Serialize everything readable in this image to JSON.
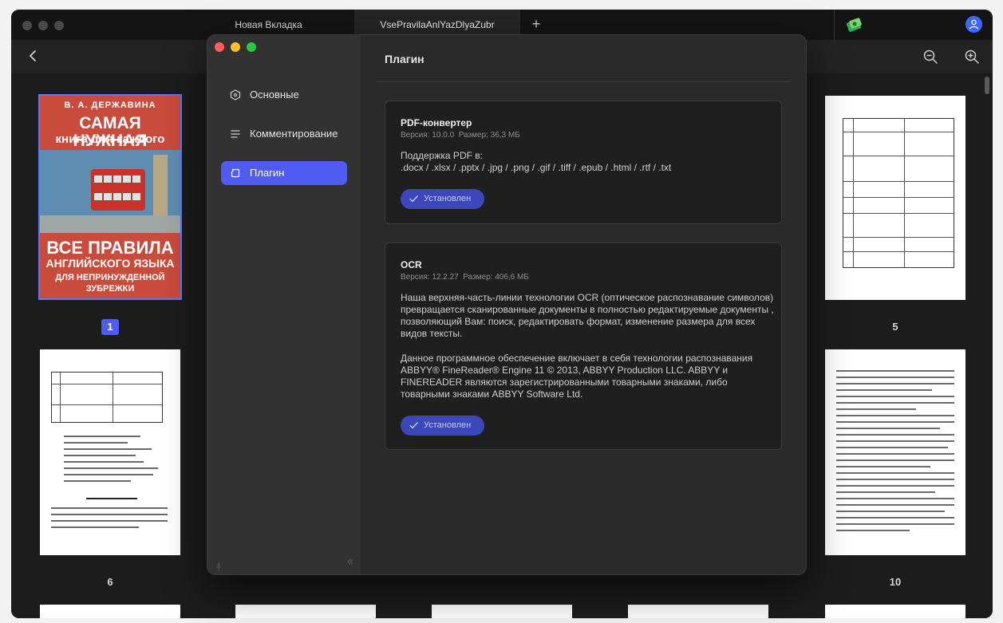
{
  "browser": {
    "tabs": [
      "Новая Вкладка",
      "VsePravilaAnlYazDlyaZubr"
    ],
    "add_tab": "+"
  },
  "icons": {
    "back": "chevron-left-icon",
    "zoom_out": "zoom-out-icon",
    "zoom_in": "zoom-in-icon",
    "extension": "extension-icon",
    "avatar": "user-avatar-icon"
  },
  "thumbnails": {
    "cover": {
      "author": "В. А. ДЕРЖАВИНА",
      "title_line1": "САМАЯ НУЖНАЯ",
      "title_line2": "книга для каждого",
      "bottom_line1": "ВСЕ ПРАВИЛА",
      "bottom_line2": "АНГЛИЙСКОГО ЯЗЫКА",
      "bottom_line3": "ДЛЯ НЕПРИНУЖДЕННОЙ",
      "bottom_line4": "ЗУБРЕЖКИ"
    },
    "pages": [
      "1",
      "5",
      "6",
      "10"
    ],
    "selected_page": "1"
  },
  "dialog": {
    "nav": [
      {
        "label": "Основные",
        "icon": "hexagon-icon"
      },
      {
        "label": "Комментирование",
        "icon": "lines-icon"
      },
      {
        "label": "Плагин",
        "icon": "plugin-icon"
      }
    ],
    "active_nav": "Плагин",
    "title": "Плагин",
    "plugins": [
      {
        "name": "PDF-конвертер",
        "version": "Версия: 10.0.0",
        "size": "Размер: 36,3 МБ",
        "desc1": "Поддержка PDF в:",
        "desc2": ".docx / .xlsx / .pptx / .jpg / .png / .gif / .tiff / .epub / .html / .rtf / .txt",
        "status": "Установлен"
      },
      {
        "name": "OCR",
        "version": "Версия: 12.2.27",
        "size": "Размер: 406,6 МБ",
        "desc1": "Наша верхняя-часть-линии технологии OCR (оптическое распознавание символов) превращается сканированные документы в полностью редактируемые документы , позволяющий Вам: поиск, редактировать формат, изменение размера для всех видов тексты.",
        "desc2": "Данное программное обеспечение включает в себя технологии распознавания ABBYY® FineReader® Engine 11 © 2013, ABBYY Production LLC. ABBYY и FINEREADER являются зарегистрированными товарными знаками, либо товарными знаками ABBYY Software Ltd.",
        "status": "Установлен"
      }
    ]
  },
  "colors": {
    "accent": "#4f5bf1",
    "installed_button": "#3c48b9",
    "background": "#1c1c1c",
    "sidebar": "#323232"
  }
}
